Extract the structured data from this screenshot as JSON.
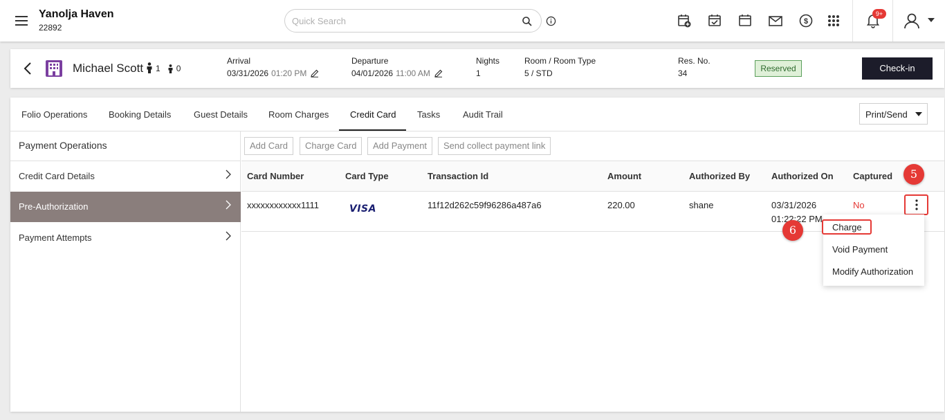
{
  "header": {
    "hotel_name": "Yanolja Haven",
    "hotel_id": "22892",
    "search_placeholder": "Quick Search",
    "notification_badge": "9+",
    "icons": [
      "menu-icon",
      "search-icon",
      "info-icon",
      "calendar-add-icon",
      "calendar-check-icon",
      "calendar-icon",
      "mail-icon",
      "dollar-icon",
      "apps-grid-icon",
      "bell-icon",
      "user-icon",
      "caret-down-icon"
    ]
  },
  "reservation": {
    "guest_name": "Michael Scott",
    "adults": "1",
    "children": "0",
    "arrival_label": "Arrival",
    "arrival_date": "03/31/2026",
    "arrival_time": "01:20 PM",
    "departure_label": "Departure",
    "departure_date": "04/01/2026",
    "departure_time": "11:00 AM",
    "nights_label": "Nights",
    "nights": "1",
    "room_label": "Room / Room Type",
    "room": "5 / STD",
    "res_no_label": "Res. No.",
    "res_no": "34",
    "status": "Reserved",
    "checkin_label": "Check-in"
  },
  "tabs": [
    {
      "label": "Folio Operations"
    },
    {
      "label": "Booking Details"
    },
    {
      "label": "Guest Details"
    },
    {
      "label": "Room Charges"
    },
    {
      "label": "Credit Card"
    },
    {
      "label": "Tasks"
    },
    {
      "label": "Audit Trail"
    }
  ],
  "active_tab": "Credit Card",
  "print_send_label": "Print/Send",
  "sidebar": {
    "title": "Payment Operations",
    "items": [
      {
        "label": "Credit Card Details"
      },
      {
        "label": "Pre-Authorization"
      },
      {
        "label": "Payment Attempts"
      }
    ],
    "selected": "Pre-Authorization"
  },
  "actions": {
    "add_card": "Add Card",
    "charge_card": "Charge Card",
    "add_payment": "Add Payment",
    "send_link": "Send collect payment link"
  },
  "table": {
    "columns": [
      "Card Number",
      "Card Type",
      "Transaction Id",
      "Amount",
      "Authorized By",
      "Authorized On",
      "Captured"
    ],
    "rows": [
      {
        "card_number": "xxxxxxxxxxxx1111",
        "card_type": "VISA",
        "transaction_id": "11f12d262c59f96286a487a6",
        "amount": "220.00",
        "authorized_by": "shane",
        "authorized_on_date": "03/31/2026",
        "authorized_on_time": "01:22:22 PM",
        "captured": "No"
      }
    ]
  },
  "row_menu": {
    "items": [
      {
        "label": "Charge"
      },
      {
        "label": "Void Payment"
      },
      {
        "label": "Modify Authorization"
      }
    ]
  },
  "annotations": {
    "step5": "5",
    "step6": "6",
    "color": "#e53935"
  },
  "colors": {
    "selected_item_bg": "#8a7e7c",
    "checkin_bg": "#1c1c2a",
    "status_bg": "#dff0d8",
    "building_icon": "#7b3fa0"
  }
}
